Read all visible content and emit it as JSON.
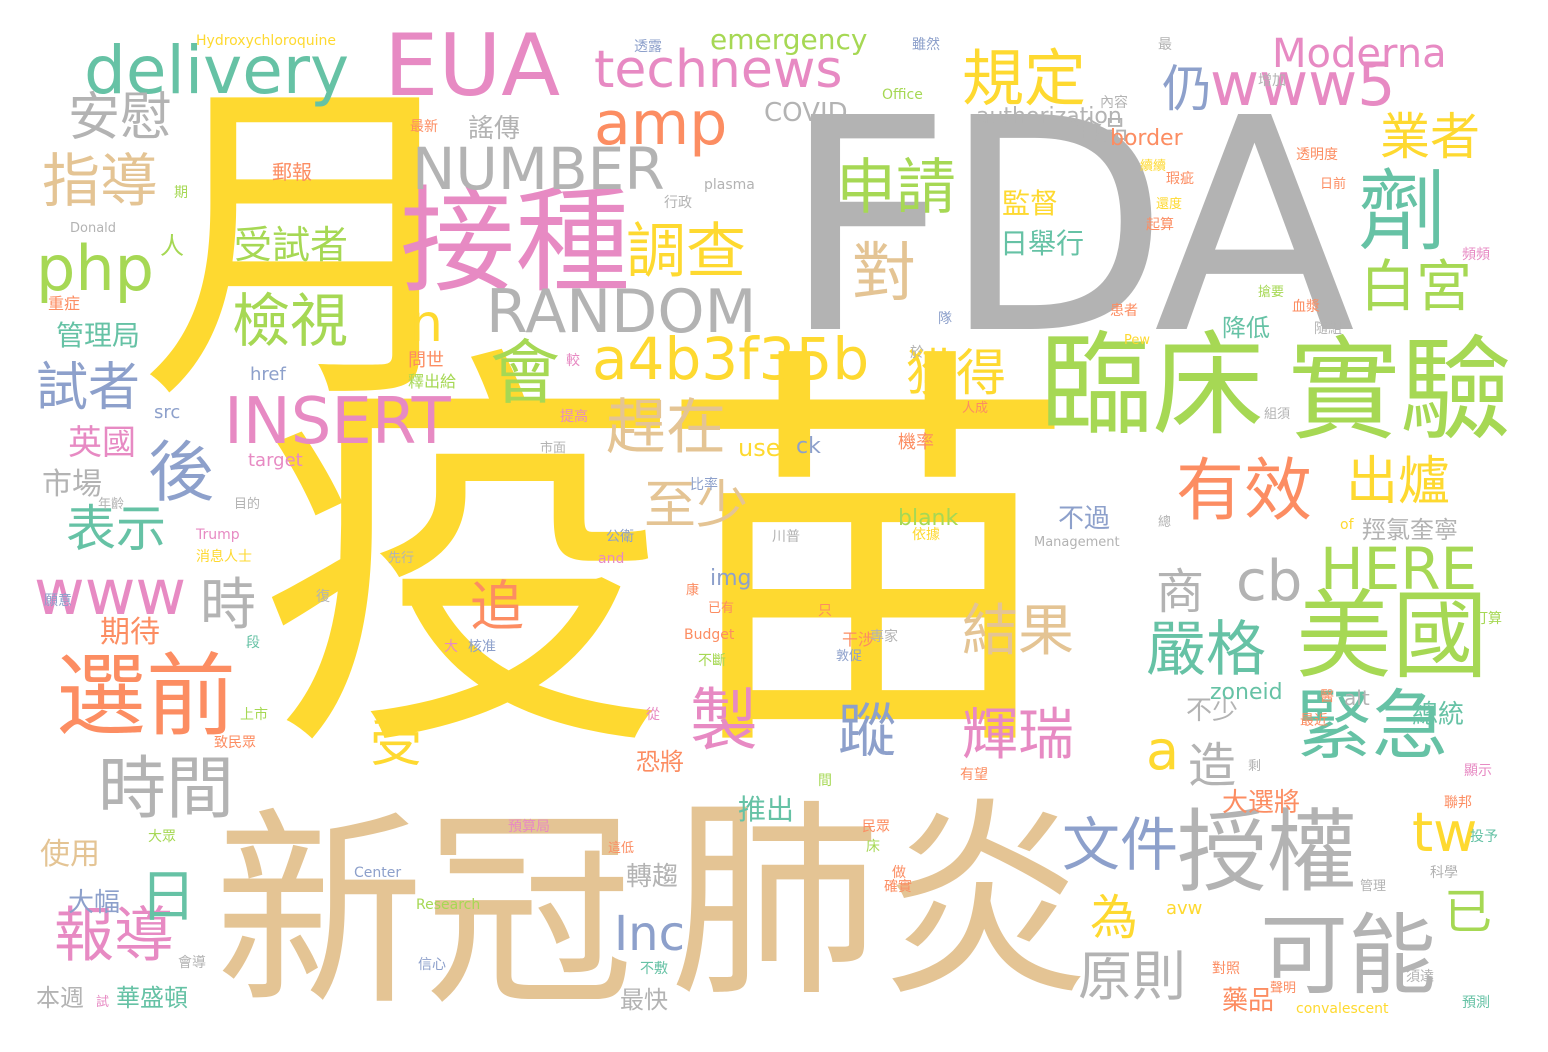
{
  "palette": {
    "yellow": "#fed930",
    "gray": "#b3b3b3",
    "tan": "#e4c494",
    "green": "#a6d854",
    "pink": "#e78ac3",
    "blue": "#8da0cb",
    "orange": "#fc8d62",
    "teal": "#66c2a5"
  },
  "words": [
    {
      "text": "疫苗",
      "color": "yellow"
    },
    {
      "text": "FDA",
      "color": "gray"
    },
    {
      "text": "月",
      "color": "yellow"
    },
    {
      "text": "新冠",
      "color": "tan"
    },
    {
      "text": "肺炎",
      "color": "tan"
    },
    {
      "text": "接種",
      "color": "pink"
    },
    {
      "text": "臨床",
      "color": "green"
    },
    {
      "text": "實驗",
      "color": "green"
    },
    {
      "text": "EUA",
      "color": "pink"
    },
    {
      "text": "授權",
      "color": "gray"
    },
    {
      "text": "美國",
      "color": "green"
    },
    {
      "text": "可能",
      "color": "gray"
    },
    {
      "text": "technews",
      "color": "pink"
    },
    {
      "text": "delivery",
      "color": "teal"
    },
    {
      "text": "劑",
      "color": "teal"
    },
    {
      "text": "選前",
      "color": "orange"
    },
    {
      "text": "NUMBER",
      "color": "gray"
    },
    {
      "text": "RANDOM",
      "color": "gray"
    },
    {
      "text": "a4b3f35b",
      "color": "yellow"
    },
    {
      "text": "INSERT",
      "color": "pink"
    },
    {
      "text": "amp",
      "color": "orange"
    },
    {
      "text": "www5",
      "color": "pink"
    },
    {
      "text": "緊急",
      "color": "teal"
    },
    {
      "text": "規定",
      "color": "yellow"
    },
    {
      "text": "申請",
      "color": "green"
    },
    {
      "text": "php",
      "color": "green"
    },
    {
      "text": "調查",
      "color": "yellow"
    },
    {
      "text": "有效",
      "color": "orange"
    },
    {
      "text": "Moderna",
      "color": "pink"
    },
    {
      "text": "www",
      "color": "pink"
    },
    {
      "text": "時間",
      "color": "gray"
    },
    {
      "text": "HERE",
      "color": "green"
    },
    {
      "text": "cb",
      "color": "gray"
    },
    {
      "text": "製",
      "color": "pink"
    },
    {
      "text": "報導",
      "color": "pink"
    },
    {
      "text": "會",
      "color": "green"
    },
    {
      "text": "後",
      "color": "blue"
    },
    {
      "text": "仍",
      "color": "blue"
    },
    {
      "text": "白宮",
      "color": "green"
    },
    {
      "text": "業者",
      "color": "yellow"
    },
    {
      "text": "指導",
      "color": "tan"
    },
    {
      "text": "安慰",
      "color": "gray"
    },
    {
      "text": "檢視",
      "color": "green"
    },
    {
      "text": "趕在",
      "color": "tan"
    },
    {
      "text": "獲得",
      "color": "yellow"
    },
    {
      "text": "嚴格",
      "color": "teal"
    },
    {
      "text": "出爐",
      "color": "yellow"
    },
    {
      "text": "文件",
      "color": "blue"
    },
    {
      "text": "原則",
      "color": "gray"
    },
    {
      "text": "對",
      "color": "tan"
    },
    {
      "text": "n",
      "color": "yellow"
    },
    {
      "text": "結果",
      "color": "tan"
    },
    {
      "text": "輝瑞",
      "color": "pink"
    },
    {
      "text": "蹤",
      "color": "blue"
    },
    {
      "text": "追",
      "color": "orange"
    },
    {
      "text": "至少",
      "color": "tan"
    },
    {
      "text": "造",
      "color": "gray"
    },
    {
      "text": "a",
      "color": "yellow"
    },
    {
      "text": "受",
      "color": "yellow"
    },
    {
      "text": "tw",
      "color": "yellow"
    },
    {
      "text": "商",
      "color": "gray"
    },
    {
      "text": "日",
      "color": "teal"
    },
    {
      "text": "時",
      "color": "gray"
    },
    {
      "text": "Inc",
      "color": "blue"
    },
    {
      "text": "已",
      "color": "green"
    },
    {
      "text": "為",
      "color": "yellow"
    },
    {
      "text": "表示",
      "color": "teal"
    },
    {
      "text": "試者",
      "color": "blue"
    },
    {
      "text": "受試者",
      "color": "green"
    },
    {
      "text": "emergency",
      "color": "green"
    },
    {
      "text": "COVID",
      "color": "gray"
    },
    {
      "text": "authorization",
      "color": "gray"
    },
    {
      "text": "英國",
      "color": "pink"
    },
    {
      "text": "管理局",
      "color": "teal"
    },
    {
      "text": "市場",
      "color": "gray"
    },
    {
      "text": "期待",
      "color": "orange"
    },
    {
      "text": "使用",
      "color": "tan"
    },
    {
      "text": "大幅",
      "color": "blue"
    },
    {
      "text": "本週",
      "color": "gray"
    },
    {
      "text": "華盛頓",
      "color": "teal"
    },
    {
      "text": "最快",
      "color": "gray"
    },
    {
      "text": "轉趨",
      "color": "gray"
    },
    {
      "text": "推出",
      "color": "teal"
    },
    {
      "text": "恐將",
      "color": "orange"
    },
    {
      "text": "不少",
      "color": "gray"
    },
    {
      "text": "大選將",
      "color": "orange"
    },
    {
      "text": "藥品",
      "color": "orange"
    },
    {
      "text": "總統",
      "color": "teal"
    },
    {
      "text": "羥氯奎寧",
      "color": "gray"
    },
    {
      "text": "zoneid",
      "color": "teal"
    },
    {
      "text": "食品",
      "color": "gray"
    },
    {
      "text": "監督",
      "color": "yellow"
    },
    {
      "text": "日舉行",
      "color": "teal"
    },
    {
      "text": "不過",
      "color": "blue"
    },
    {
      "text": "降低",
      "color": "teal"
    },
    {
      "text": "謠傳",
      "color": "gray"
    },
    {
      "text": "border",
      "color": "orange"
    },
    {
      "text": "blank",
      "color": "green"
    },
    {
      "text": "use",
      "color": "yellow"
    },
    {
      "text": "ck",
      "color": "blue"
    },
    {
      "text": "img",
      "color": "blue"
    },
    {
      "text": "avw",
      "color": "yellow"
    },
    {
      "text": "alt",
      "color": "gray"
    },
    {
      "text": "href",
      "color": "blue"
    },
    {
      "text": "src",
      "color": "blue"
    },
    {
      "text": "target",
      "color": "pink"
    },
    {
      "text": "人",
      "color": "green"
    },
    {
      "text": "plasma",
      "color": "gray"
    },
    {
      "text": "Hydroxychloroquine",
      "color": "yellow"
    },
    {
      "text": "Office",
      "color": "green"
    },
    {
      "text": "Pew",
      "color": "yellow"
    },
    {
      "text": "Trump",
      "color": "pink"
    },
    {
      "text": "Management",
      "color": "gray"
    },
    {
      "text": "and",
      "color": "pink"
    },
    {
      "text": "of",
      "color": "yellow"
    },
    {
      "text": "Budget",
      "color": "orange"
    },
    {
      "text": "Center",
      "color": "blue"
    },
    {
      "text": "Research",
      "color": "green"
    },
    {
      "text": "convalescent",
      "color": "yellow"
    },
    {
      "text": "Donald",
      "color": "gray"
    },
    {
      "text": "郵報",
      "color": "orange"
    },
    {
      "text": "內容",
      "color": "gray"
    },
    {
      "text": "增加",
      "color": "gray"
    },
    {
      "text": "透明度",
      "color": "orange"
    },
    {
      "text": "期",
      "color": "green"
    },
    {
      "text": "行政",
      "color": "gray"
    },
    {
      "text": "重症",
      "color": "orange"
    },
    {
      "text": "問世",
      "color": "orange"
    },
    {
      "text": "釋出給",
      "color": "green"
    },
    {
      "text": "患者",
      "color": "orange"
    },
    {
      "text": "血漿",
      "color": "orange"
    },
    {
      "text": "提高",
      "color": "pink"
    },
    {
      "text": "市面",
      "color": "gray"
    },
    {
      "text": "比率",
      "color": "blue"
    },
    {
      "text": "機率",
      "color": "orange"
    },
    {
      "text": "目的",
      "color": "gray"
    },
    {
      "text": "消息人士",
      "color": "yellow"
    },
    {
      "text": "公衛",
      "color": "blue"
    },
    {
      "text": "依據",
      "color": "yellow"
    },
    {
      "text": "川普",
      "color": "gray"
    },
    {
      "text": "先行",
      "color": "gray"
    },
    {
      "text": "干涉",
      "color": "orange"
    },
    {
      "text": "核准",
      "color": "blue"
    },
    {
      "text": "敦促",
      "color": "blue"
    },
    {
      "text": "專家",
      "color": "gray"
    },
    {
      "text": "上市",
      "color": "green"
    },
    {
      "text": "致民眾",
      "color": "orange"
    },
    {
      "text": "預算局",
      "color": "pink"
    },
    {
      "text": "民眾",
      "color": "orange"
    },
    {
      "text": "科學",
      "color": "gray"
    },
    {
      "text": "投予",
      "color": "teal"
    },
    {
      "text": "打算",
      "color": "green"
    },
    {
      "text": "聯邦",
      "color": "orange"
    },
    {
      "text": "顯示",
      "color": "pink"
    },
    {
      "text": "最近",
      "color": "orange"
    },
    {
      "text": "有望",
      "color": "orange"
    },
    {
      "text": "不斷",
      "color": "green"
    },
    {
      "text": "信心",
      "color": "blue"
    },
    {
      "text": "不敷",
      "color": "teal"
    },
    {
      "text": "對照",
      "color": "orange"
    },
    {
      "text": "須達",
      "color": "gray"
    },
    {
      "text": "預測",
      "color": "teal"
    },
    {
      "text": "聲明",
      "color": "orange"
    },
    {
      "text": "確實",
      "color": "orange"
    },
    {
      "text": "會導",
      "color": "gray"
    },
    {
      "text": "雖然",
      "color": "blue"
    },
    {
      "text": "透露",
      "color": "blue"
    },
    {
      "text": "最新",
      "color": "orange"
    },
    {
      "text": "瑕疵",
      "color": "orange"
    },
    {
      "text": "日前",
      "color": "orange"
    },
    {
      "text": "組須",
      "color": "gray"
    },
    {
      "text": "起算",
      "color": "orange"
    },
    {
      "text": "頻頻",
      "color": "pink"
    },
    {
      "text": "隨組",
      "color": "gray"
    },
    {
      "text": "搶要",
      "color": "green"
    },
    {
      "text": "人成",
      "color": "orange"
    },
    {
      "text": "管理",
      "color": "gray"
    },
    {
      "text": "這低",
      "color": "orange"
    },
    {
      "text": "還度",
      "color": "yellow"
    },
    {
      "text": "總",
      "color": "gray"
    },
    {
      "text": "康",
      "color": "orange"
    },
    {
      "text": "剩",
      "color": "gray"
    },
    {
      "text": "已有",
      "color": "orange"
    },
    {
      "text": "較",
      "color": "pink"
    },
    {
      "text": "隊",
      "color": "blue"
    },
    {
      "text": "於",
      "color": "gray"
    },
    {
      "text": "最",
      "color": "gray"
    },
    {
      "text": "復",
      "color": "gray"
    },
    {
      "text": "段",
      "color": "teal"
    },
    {
      "text": "從",
      "color": "pink"
    },
    {
      "text": "間",
      "color": "green"
    },
    {
      "text": "只",
      "color": "orange"
    },
    {
      "text": "大",
      "color": "pink"
    },
    {
      "text": "床",
      "color": "green"
    },
    {
      "text": "做",
      "color": "orange"
    },
    {
      "text": "醫",
      "color": "orange"
    },
    {
      "text": "試",
      "color": "pink"
    },
    {
      "text": "大眾",
      "color": "green"
    },
    {
      "text": "願意",
      "color": "blue"
    },
    {
      "text": "年齡",
      "color": "gray"
    },
    {
      "text": "續續",
      "color": "yellow"
    }
  ]
}
